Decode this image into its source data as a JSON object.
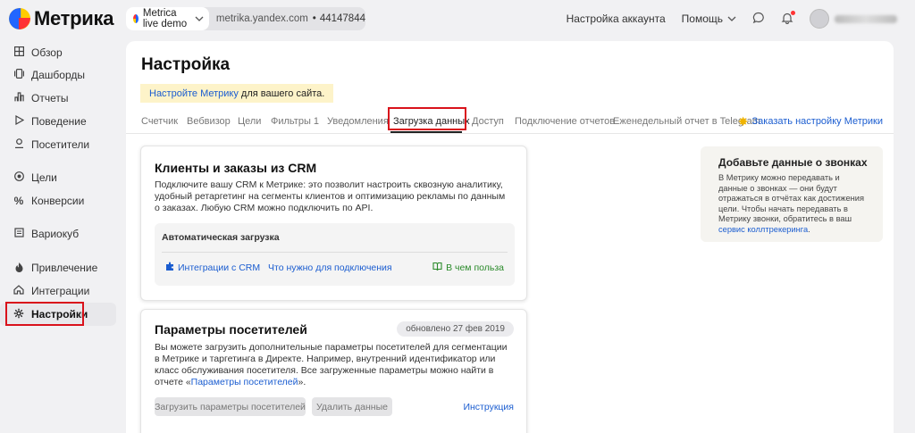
{
  "header": {
    "logo_text": "Метрика",
    "counter_name": "Metrica live demo",
    "counter_url": "metrika.yandex.com",
    "counter_id": "44147844",
    "account_settings": "Настройка аккаунта",
    "help": "Помощь"
  },
  "sidebar": {
    "items": [
      {
        "label": "Обзор",
        "icon": "grid-icon"
      },
      {
        "label": "Дашборды",
        "icon": "dashboard-icon"
      },
      {
        "label": "Отчеты",
        "icon": "reports-icon"
      },
      {
        "label": "Поведение",
        "icon": "play-icon"
      },
      {
        "label": "Посетители",
        "icon": "person-icon"
      },
      {
        "label": "Цели",
        "icon": "target-icon"
      },
      {
        "label": "Конверсии",
        "icon": "percent-icon"
      },
      {
        "label": "Вариокуб",
        "icon": "cube-icon"
      },
      {
        "label": "Привлечение",
        "icon": "flame-icon"
      },
      {
        "label": "Интеграции",
        "icon": "integration-icon"
      },
      {
        "label": "Настройки",
        "icon": "gear-icon"
      }
    ]
  },
  "main": {
    "title": "Настройка",
    "notice_link": "Настройте Метрику",
    "notice_rest": " для вашего сайта.",
    "tabs": [
      "Счетчик",
      "Вебвизор",
      "Цели",
      "Фильтры 1",
      "Уведомления",
      "Загрузка данных",
      "Доступ",
      "Подключение отчетов",
      "Еженедельный отчет в Telegram"
    ],
    "active_tab": "Загрузка данных",
    "order_link": "Заказать настройку Метрики"
  },
  "crm_card": {
    "title": "Клиенты и заказы из CRM",
    "text": "Подключите вашу CRM к Метрике: это позволит настроить сквозную аналитику, удобный ретаргетинг на сегменты клиентов и оптимизацию рекламы по данным о заказах. Любую CRM можно подключить по API.",
    "auto_load": "Автоматическая загрузка",
    "integrations_link": "Интеграции с CRM",
    "requirements_link": "Что нужно для подключения",
    "benefit_link": "В чем польза"
  },
  "visitor_card": {
    "title": "Параметры посетителей",
    "updated": "обновлено 27 фев 2019",
    "text_pre": "Вы можете загрузить дополнительные параметры посетителей для сегментации в Метрике и таргетинга в Директе. Например, внутренний идентификатор или класс обслуживания посетителя. Все загруженные параметры можно найти в отчете «",
    "report_link": "Параметры посетителей",
    "text_post": "».",
    "upload_button": "Загрузить параметры посетителей",
    "delete_button": "Удалить данные",
    "instruction_link": "Инструкция"
  },
  "calls_card": {
    "title": "Добавьте данные о звонках",
    "text": "В Метрику можно передавать и данные о звонках — они будут отражаться в отчётах как достижения цели. Чтобы начать передавать в Метрику звонки, обратитесь в ваш ",
    "link": "сервис коллтрекеринга",
    "text_end": "."
  },
  "colors": {
    "accent_link": "#1b5dd0",
    "highlight": "#d9121b",
    "notice_bg": "#fdf3c9"
  }
}
